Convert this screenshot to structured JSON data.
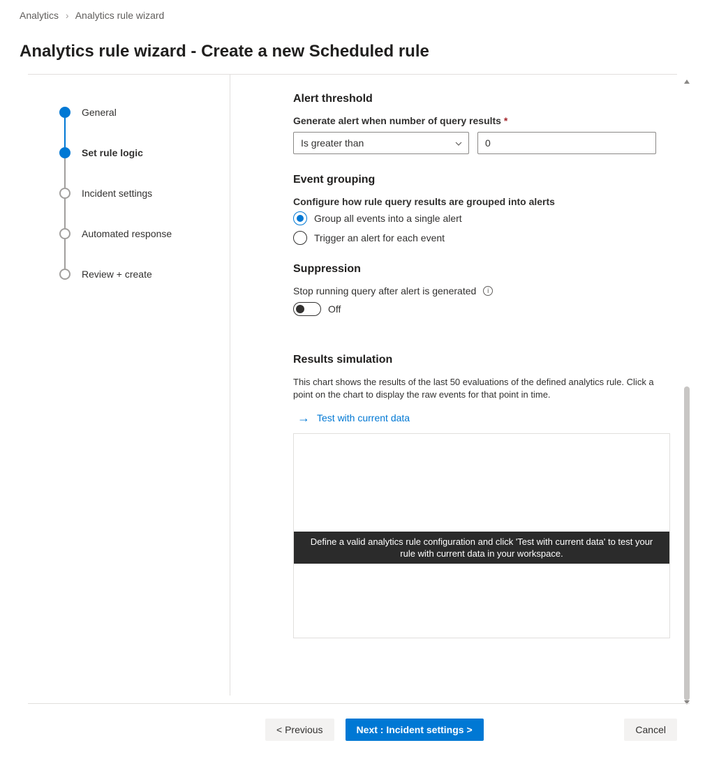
{
  "breadcrumb": {
    "root": "Analytics",
    "current": "Analytics rule wizard"
  },
  "page_title": "Analytics rule wizard - Create a new Scheduled rule",
  "stepper": {
    "steps": [
      {
        "label": "General"
      },
      {
        "label": "Set rule logic"
      },
      {
        "label": "Incident settings"
      },
      {
        "label": "Automated response"
      },
      {
        "label": "Review + create"
      }
    ]
  },
  "alert_threshold": {
    "heading": "Alert threshold",
    "label": "Generate alert when number of query results",
    "required_mark": "*",
    "operator": "Is greater than",
    "value": "0"
  },
  "event_grouping": {
    "heading": "Event grouping",
    "label": "Configure how rule query results are grouped into alerts",
    "options": [
      "Group all events into a single alert",
      "Trigger an alert for each event"
    ]
  },
  "suppression": {
    "heading": "Suppression",
    "label": "Stop running query after alert is generated",
    "toggle_state": "Off"
  },
  "results_simulation": {
    "heading": "Results simulation",
    "desc": "This chart shows the results of the last 50 evaluations of the defined analytics rule. Click a point on the chart to display the raw events for that point in time.",
    "test_link": "Test with current data",
    "overlay": "Define a valid analytics rule configuration and click 'Test with current data' to test your rule with current data in your workspace."
  },
  "footer": {
    "previous": "< Previous",
    "next": "Next : Incident settings >",
    "cancel": "Cancel"
  }
}
